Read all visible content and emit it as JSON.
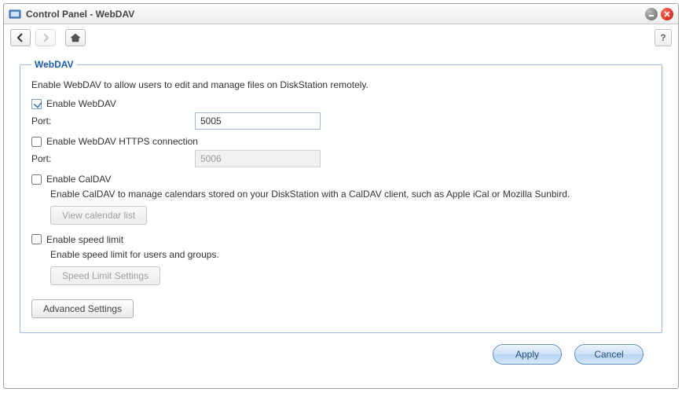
{
  "window": {
    "title": "Control Panel - WebDAV"
  },
  "group": {
    "legend": "WebDAV",
    "description": "Enable WebDAV to allow users to edit and manage files on DiskStation remotely."
  },
  "webdav": {
    "checkbox_label": "Enable WebDAV",
    "port_label": "Port:",
    "port_value": "5005"
  },
  "https": {
    "checkbox_label": "Enable WebDAV HTTPS connection",
    "port_label": "Port:",
    "port_value": "5006"
  },
  "caldav": {
    "checkbox_label": "Enable CalDAV",
    "description": "Enable CalDAV to manage calendars stored on your DiskStation with a CalDAV client, such as Apple iCal or Mozilla Sunbird.",
    "view_button": "View calendar list"
  },
  "speed": {
    "checkbox_label": "Enable speed limit",
    "description": "Enable speed limit for users and groups.",
    "settings_button": "Speed Limit Settings"
  },
  "advanced_button": "Advanced Settings",
  "footer": {
    "apply": "Apply",
    "cancel": "Cancel"
  },
  "help_tooltip": "?"
}
